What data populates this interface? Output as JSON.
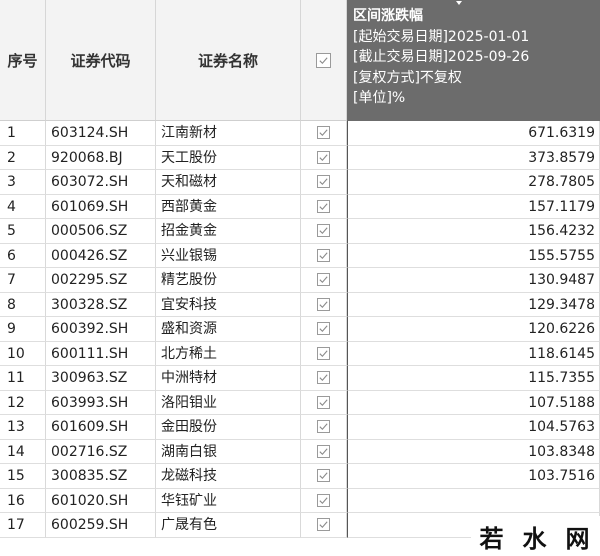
{
  "header": {
    "col_no": "序号",
    "col_code": "证券代码",
    "col_name": "证券名称",
    "col_value_title": "区间涨跌幅",
    "col_value_lines": [
      "[起始交易日期]2025-01-01",
      "[截止交易日期]2025-09-26",
      "[复权方式]不复权",
      "[单位]%"
    ]
  },
  "rows": [
    {
      "no": "1",
      "code": "603124.SH",
      "name": "江南新材",
      "value": "671.6319"
    },
    {
      "no": "2",
      "code": "920068.BJ",
      "name": "天工股份",
      "value": "373.8579"
    },
    {
      "no": "3",
      "code": "603072.SH",
      "name": "天和磁材",
      "value": "278.7805"
    },
    {
      "no": "4",
      "code": "601069.SH",
      "name": "西部黄金",
      "value": "157.1179"
    },
    {
      "no": "5",
      "code": "000506.SZ",
      "name": "招金黄金",
      "value": "156.4232"
    },
    {
      "no": "6",
      "code": "000426.SZ",
      "name": "兴业银锡",
      "value": "155.5755"
    },
    {
      "no": "7",
      "code": "002295.SZ",
      "name": "精艺股份",
      "value": "130.9487"
    },
    {
      "no": "8",
      "code": "300328.SZ",
      "name": "宜安科技",
      "value": "129.3478"
    },
    {
      "no": "9",
      "code": "600392.SH",
      "name": "盛和资源",
      "value": "120.6226"
    },
    {
      "no": "10",
      "code": "600111.SH",
      "name": "北方稀土",
      "value": "118.6145"
    },
    {
      "no": "11",
      "code": "300963.SZ",
      "name": "中洲特材",
      "value": "115.7355"
    },
    {
      "no": "12",
      "code": "603993.SH",
      "name": "洛阳钼业",
      "value": "107.5188"
    },
    {
      "no": "13",
      "code": "601609.SH",
      "name": "金田股份",
      "value": "104.5763"
    },
    {
      "no": "14",
      "code": "002716.SZ",
      "name": "湖南白银",
      "value": "103.8348"
    },
    {
      "no": "15",
      "code": "300835.SZ",
      "name": "龙磁科技",
      "value": "103.7516"
    },
    {
      "no": "16",
      "code": "601020.SH",
      "name": "华钰矿业",
      "value": ""
    },
    {
      "no": "17",
      "code": "600259.SH",
      "name": "广晟有色",
      "value": ""
    }
  ],
  "watermark": [
    "若",
    "水",
    "网"
  ],
  "colors": {
    "header_bg": "#f3f3f3",
    "value_header_bg": "#6c6c6c",
    "grid_line": "#d9d9d9"
  }
}
